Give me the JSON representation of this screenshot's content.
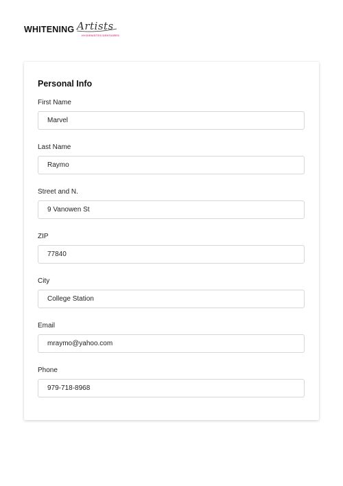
{
  "brand": {
    "wordmark": "WHITENING",
    "script": "Artists",
    "tagline": "HYGIENISTES DENTAIRES"
  },
  "form": {
    "title": "Personal Info",
    "fields": [
      {
        "label": "First Name",
        "value": "Marvel"
      },
      {
        "label": "Last Name",
        "value": "Raymo"
      },
      {
        "label": "Street and N.",
        "value": "9 Vanowen St"
      },
      {
        "label": "ZIP",
        "value": "77840"
      },
      {
        "label": "City",
        "value": "College Station"
      },
      {
        "label": "Email",
        "value": "mraymo@yahoo.com"
      },
      {
        "label": "Phone",
        "value": "979-718-8968"
      }
    ]
  },
  "colors": {
    "tagline_pink": "#e0509a",
    "input_border": "#d6d6d6"
  }
}
